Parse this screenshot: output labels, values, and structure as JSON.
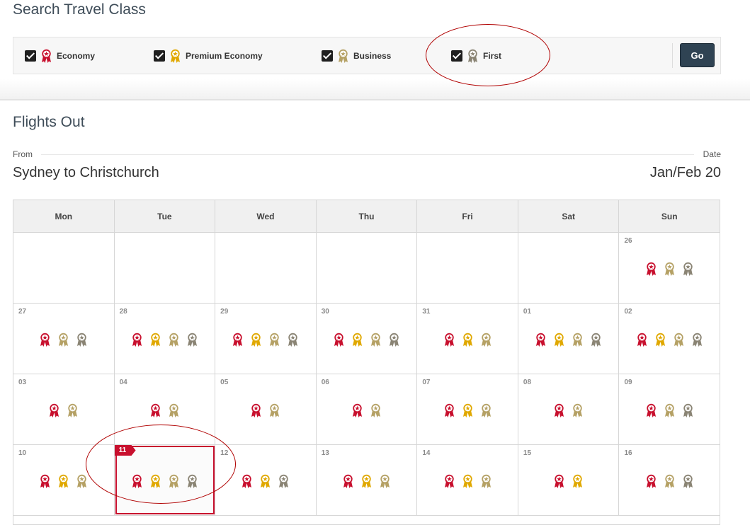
{
  "search": {
    "title": "Search Travel Class",
    "classes": [
      {
        "label": "Economy",
        "icon": "economy-medal-icon",
        "color": "#c8102e",
        "checked": true
      },
      {
        "label": "Premium Economy",
        "icon": "premium-economy-medal-icon",
        "color": "#e0a800",
        "checked": true
      },
      {
        "label": "Business",
        "icon": "business-medal-icon",
        "color": "#b5a165",
        "checked": true
      },
      {
        "label": "First",
        "icon": "first-medal-icon",
        "color": "#8a8474",
        "checked": true
      }
    ],
    "go_label": "Go"
  },
  "flights": {
    "title": "Flights Out",
    "from_label": "From",
    "date_label": "Date",
    "route": "Sydney to Christchurch",
    "date_value": "Jan/Feb 20"
  },
  "calendar": {
    "weekdays": [
      "Mon",
      "Tue",
      "Wed",
      "Thu",
      "Fri",
      "Sat",
      "Sun"
    ],
    "selected_day": "11",
    "class_colors": {
      "E": "#c8102e",
      "P": "#e0a800",
      "B": "#b5a165",
      "F": "#8a8474"
    },
    "weeks": [
      [
        {
          "day": "",
          "classes": []
        },
        {
          "day": "",
          "classes": []
        },
        {
          "day": "",
          "classes": []
        },
        {
          "day": "",
          "classes": []
        },
        {
          "day": "",
          "classes": []
        },
        {
          "day": "",
          "classes": []
        },
        {
          "day": "26",
          "classes": [
            "E",
            "B",
            "F"
          ]
        }
      ],
      [
        {
          "day": "27",
          "classes": [
            "E",
            "B",
            "F"
          ]
        },
        {
          "day": "28",
          "classes": [
            "E",
            "P",
            "B",
            "F"
          ]
        },
        {
          "day": "29",
          "classes": [
            "E",
            "P",
            "B",
            "F"
          ]
        },
        {
          "day": "30",
          "classes": [
            "E",
            "P",
            "B",
            "F"
          ]
        },
        {
          "day": "31",
          "classes": [
            "E",
            "P",
            "B"
          ]
        },
        {
          "day": "01",
          "classes": [
            "E",
            "P",
            "B",
            "F"
          ]
        },
        {
          "day": "02",
          "classes": [
            "E",
            "P",
            "B",
            "F"
          ]
        }
      ],
      [
        {
          "day": "03",
          "classes": [
            "E",
            "B"
          ]
        },
        {
          "day": "04",
          "classes": [
            "E",
            "B"
          ]
        },
        {
          "day": "05",
          "classes": [
            "E",
            "B"
          ]
        },
        {
          "day": "06",
          "classes": [
            "E",
            "B"
          ]
        },
        {
          "day": "07",
          "classes": [
            "E",
            "P",
            "B"
          ]
        },
        {
          "day": "08",
          "classes": [
            "E",
            "B"
          ]
        },
        {
          "day": "09",
          "classes": [
            "E",
            "B",
            "F"
          ]
        }
      ],
      [
        {
          "day": "10",
          "classes": [
            "E",
            "P",
            "B"
          ]
        },
        {
          "day": "11",
          "classes": [
            "E",
            "P",
            "B",
            "F"
          ]
        },
        {
          "day": "12",
          "classes": [
            "E",
            "P",
            "F"
          ]
        },
        {
          "day": "13",
          "classes": [
            "E",
            "P",
            "B"
          ]
        },
        {
          "day": "14",
          "classes": [
            "E",
            "P",
            "B"
          ]
        },
        {
          "day": "15",
          "classes": [
            "E",
            "P"
          ]
        },
        {
          "day": "16",
          "classes": [
            "E",
            "B",
            "F"
          ]
        }
      ]
    ]
  }
}
